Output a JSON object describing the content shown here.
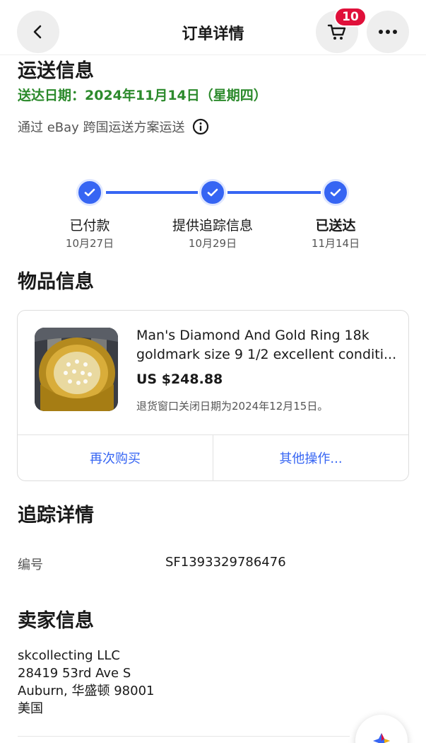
{
  "header": {
    "title": "订单详情",
    "cart_count": "10"
  },
  "shipping": {
    "heading": "运送信息",
    "delivery_date": "送达日期：2024年11月14日（星期四）",
    "method": "通过 eBay 跨国运送方案运送"
  },
  "progress": {
    "steps": [
      {
        "label": "已付款",
        "date": "10月27日"
      },
      {
        "label": "提供追踪信息",
        "date": "10月29日"
      },
      {
        "label": "已送达",
        "date": "11月14日"
      }
    ]
  },
  "item": {
    "heading": "物品信息",
    "title_line1": "Man's Diamond And Gold Ring 18k",
    "title_line2": "goldmark size 9 1/2 excellent conditi...",
    "price": "US $248.88",
    "return_note": "退货窗口关闭日期为2024年12月15日。",
    "buy_again": "再次购买",
    "other_actions": "其他操作..."
  },
  "tracking": {
    "heading": "追踪详情",
    "number_label": "编号",
    "number_value": "SF1393329786476"
  },
  "seller": {
    "heading": "卖家信息",
    "line1": "skcollecting LLC",
    "line2": "28419 53rd Ave S",
    "line3": "Auburn, 华盛顿 98001",
    "line4": "美国"
  },
  "colors": {
    "accent": "#3665f3",
    "success": "#2c8a2c",
    "badge": "#e0103a"
  }
}
